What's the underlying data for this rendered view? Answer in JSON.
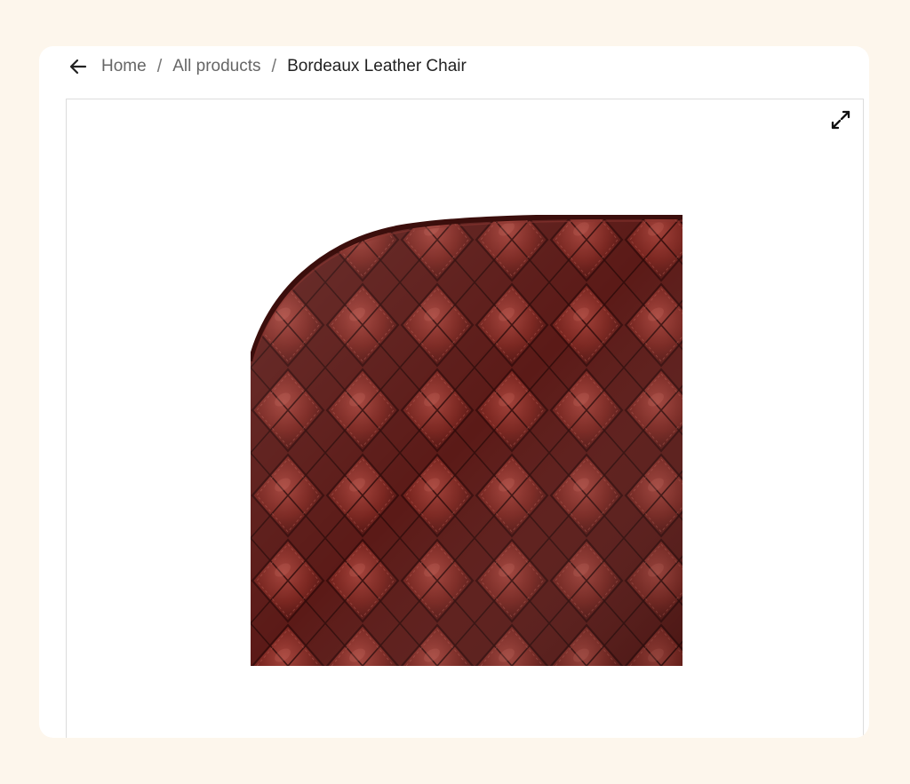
{
  "breadcrumb": {
    "back_icon": "arrow-left-icon",
    "items": [
      "Home",
      "All products"
    ],
    "current": "Bordeaux Leather Chair"
  },
  "gallery": {
    "expand_icon": "expand-icon",
    "image_subject": "quilted bordeaux leather"
  },
  "colors": {
    "page_background": "#fdf6ec",
    "card_background": "#ffffff",
    "leather": "#6e1f1c",
    "leather_highlight": "#9b3a32",
    "leather_shadow": "#3e0f0e"
  }
}
